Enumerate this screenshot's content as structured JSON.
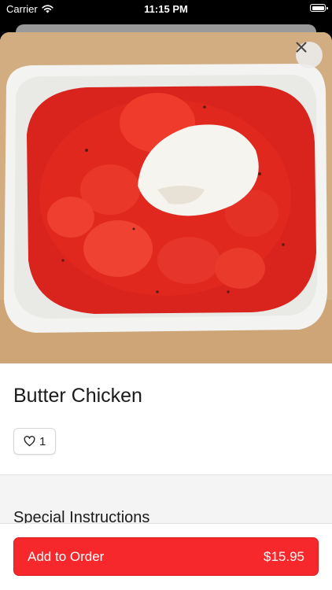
{
  "status_bar": {
    "carrier": "Carrier",
    "time": "11:15 PM"
  },
  "item": {
    "name": "Butter Chicken",
    "likes": "1"
  },
  "sections": {
    "instructions_title": "Special Instructions"
  },
  "footer": {
    "add_label": "Add to Order",
    "price": "$15.95"
  },
  "icons": {
    "close": "close-icon",
    "heart": "heart-icon",
    "wifi": "wifi-icon",
    "battery": "battery-icon"
  },
  "colors": {
    "accent": "#f6282b"
  }
}
